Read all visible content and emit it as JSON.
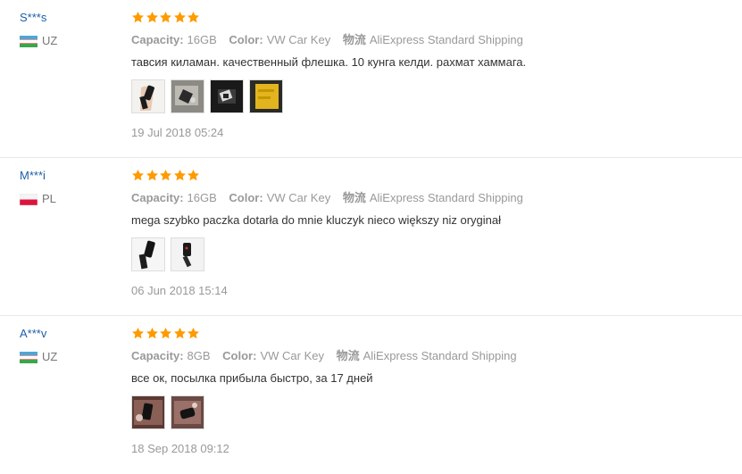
{
  "reviews": [
    {
      "user": "S***s",
      "country": "UZ",
      "flag": "uz",
      "stars": 5,
      "capacity_label": "Capacity:",
      "capacity_value": "16GB",
      "color_label": "Color:",
      "color_value": "VW Car Key",
      "shipping_label": "物流",
      "shipping_value": "AliExpress Standard Shipping",
      "text": "тавсия киламан. качественный флешка. 10 кунга келди. рахмат хаммага.",
      "photos": [
        "photo-key-hand",
        "photo-key-box",
        "photo-key-dark",
        "photo-package-yellow"
      ],
      "date": "19 Jul 2018 05:24"
    },
    {
      "user": "M***i",
      "country": "PL",
      "flag": "pl",
      "stars": 5,
      "capacity_label": "Capacity:",
      "capacity_value": "16GB",
      "color_label": "Color:",
      "color_value": "VW Car Key",
      "shipping_label": "物流",
      "shipping_value": "AliExpress Standard Shipping",
      "text": "mega szybko paczka dotarła do mnie kluczyk nieco większy niz oryginał",
      "photos": [
        "photo-key-hand",
        "photo-key-open"
      ],
      "date": "06 Jun 2018 15:14"
    },
    {
      "user": "A***v",
      "country": "UZ",
      "flag": "uz",
      "stars": 5,
      "capacity_label": "Capacity:",
      "capacity_value": "8GB",
      "color_label": "Color:",
      "color_value": "VW Car Key",
      "shipping_label": "物流",
      "shipping_value": "AliExpress Standard Shipping",
      "text": "все ок, посылка прибыла быстро, за 17 дней",
      "photos": [
        "photo-key-red",
        "photo-key-dark"
      ],
      "date": "18 Sep 2018 09:12"
    }
  ],
  "colors": {
    "star": "#ff9a00",
    "username": "#1d5ea8",
    "meta": "#999999",
    "text": "#333333"
  }
}
